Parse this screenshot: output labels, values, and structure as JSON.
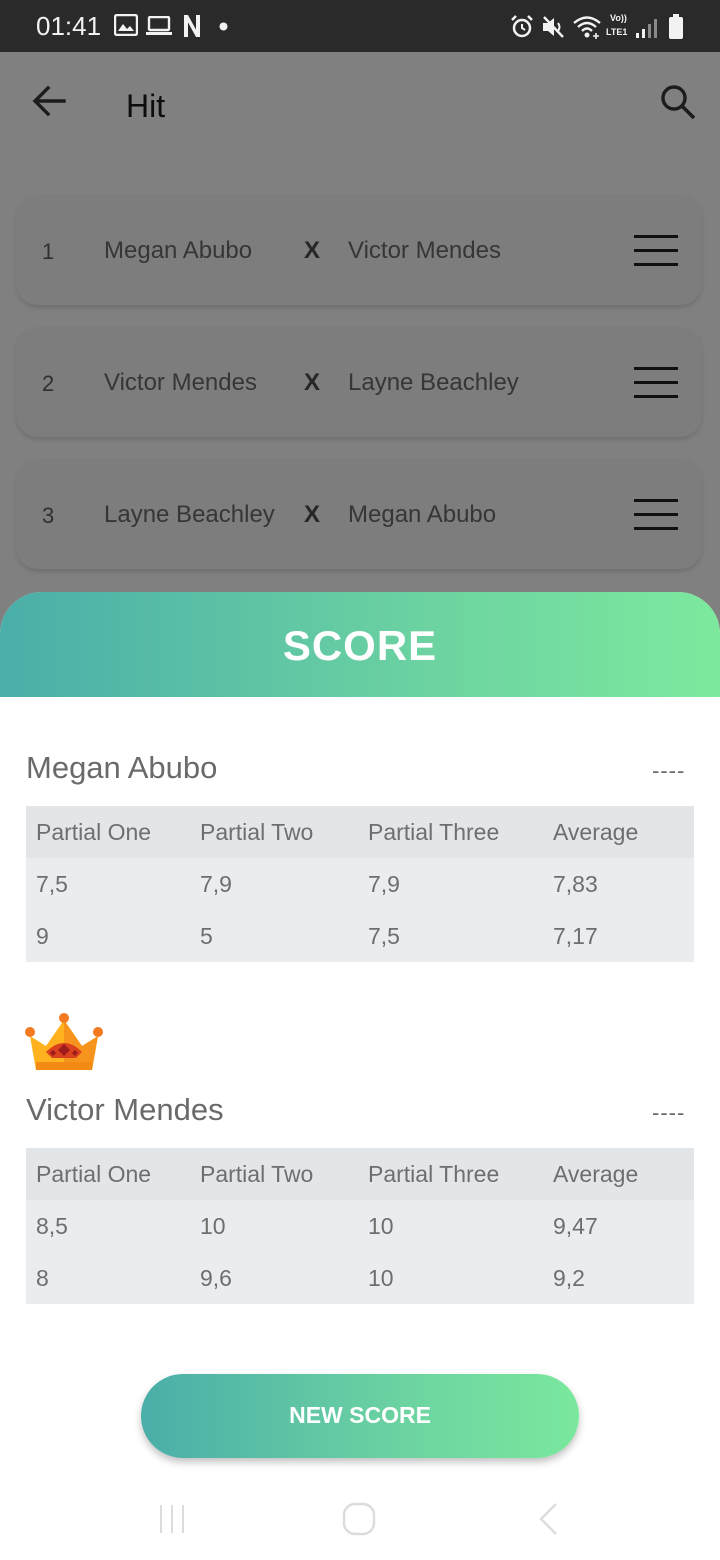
{
  "status_bar": {
    "time": "01:41",
    "network_label_top": "Vo))",
    "network_label_bottom": "LTE1",
    "icons": [
      "gallery-icon",
      "laptop-icon",
      "netflix-icon",
      "dot-icon",
      "alarm-icon",
      "mute-icon",
      "wifi-icon",
      "signal-icon",
      "battery-icon"
    ]
  },
  "toolbar": {
    "title": "Hit",
    "back_icon": "arrow-back-icon",
    "search_icon": "search-icon"
  },
  "matches": [
    {
      "number": "1",
      "player_one": "Megan Abubo",
      "vs": "X",
      "player_two": "Victor Mendes"
    },
    {
      "number": "2",
      "player_one": "Victor Mendes",
      "vs": "X",
      "player_two": "Layne Beachley"
    },
    {
      "number": "3",
      "player_one": "Layne Beachley",
      "vs": "X",
      "player_two": "Megan Abubo"
    }
  ],
  "score_sheet": {
    "title": "SCORE",
    "button_label": "NEW SCORE",
    "players": [
      {
        "name": "Megan Abubo",
        "dash": "----",
        "winner": false,
        "columns": [
          "Partial One",
          "Partial Two",
          "Partial Three",
          "Average"
        ],
        "rows": [
          [
            "7,5",
            "7,9",
            "7,9",
            "7,83"
          ],
          [
            "9",
            "5",
            "7,5",
            "7,17"
          ]
        ]
      },
      {
        "name": "Victor Mendes",
        "dash": "----",
        "winner": true,
        "columns": [
          "Partial One",
          "Partial Two",
          "Partial Three",
          "Average"
        ],
        "rows": [
          [
            "8,5",
            "10",
            "10",
            "9,47"
          ],
          [
            "8",
            "9,6",
            "10",
            "9,2"
          ]
        ]
      }
    ]
  },
  "colors": {
    "accent_start": "#4aaea9",
    "accent_end": "#7de99e",
    "overlay_bg": "#808080",
    "table_bg": "#eaedf0"
  }
}
